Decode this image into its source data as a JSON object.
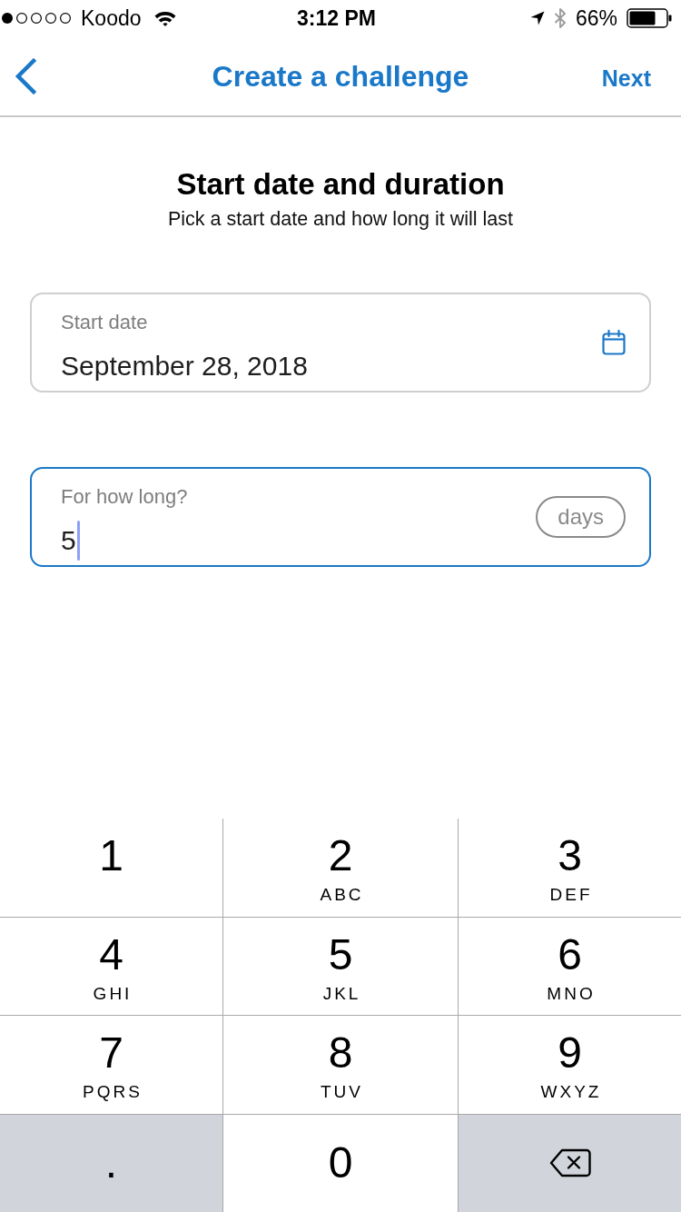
{
  "status_bar": {
    "carrier": "Koodo",
    "time": "3:12 PM",
    "battery": "66%"
  },
  "nav": {
    "title": "Create a challenge",
    "action": "Next"
  },
  "header": {
    "title": "Start date and duration",
    "subtitle": "Pick a start date and how long it will last"
  },
  "fields": [
    {
      "kind": "date",
      "label": "Start date",
      "value": "September 28, 2018",
      "focused": false
    },
    {
      "kind": "number",
      "label": "For how long?",
      "value": "5",
      "unit": "days",
      "focused": true
    }
  ],
  "keypad": {
    "rows": [
      [
        {
          "kind": "digit",
          "digit": "1"
        },
        {
          "kind": "digit",
          "digit": "2",
          "letters": "ABC"
        },
        {
          "kind": "digit",
          "digit": "3",
          "letters": "DEF"
        }
      ],
      [
        {
          "kind": "digit",
          "digit": "4",
          "letters": "GHI"
        },
        {
          "kind": "digit",
          "digit": "5",
          "letters": "JKL"
        },
        {
          "kind": "digit",
          "digit": "6",
          "letters": "MNO"
        }
      ],
      [
        {
          "kind": "digit",
          "digit": "7",
          "letters": "PQRS"
        },
        {
          "kind": "digit",
          "digit": "8",
          "letters": "TUV"
        },
        {
          "kind": "digit",
          "digit": "9",
          "letters": "WXYZ"
        }
      ],
      [
        {
          "kind": "symbol",
          "digit": "."
        },
        {
          "kind": "plain",
          "digit": "0"
        },
        {
          "kind": "delete"
        }
      ]
    ]
  }
}
